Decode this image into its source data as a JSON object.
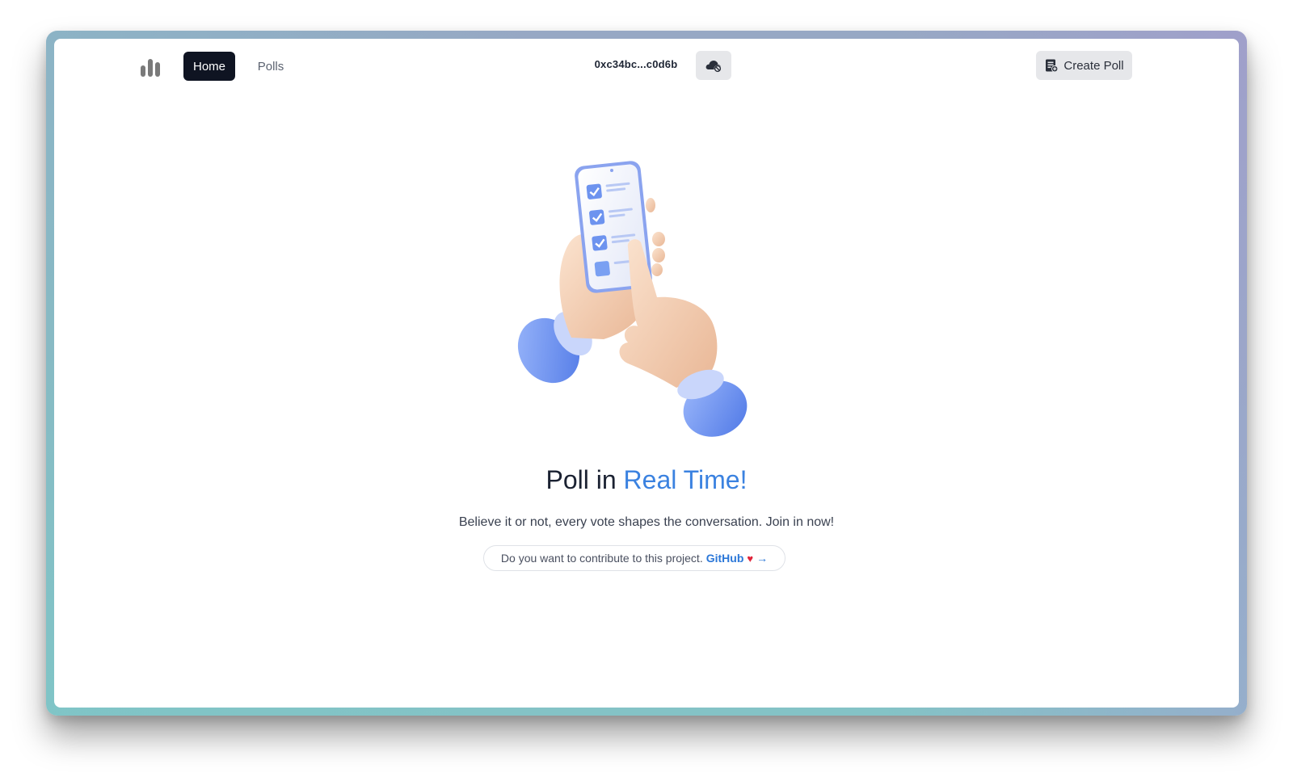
{
  "nav": {
    "logo_icon": "bar-chart-icon",
    "home_label": "Home",
    "polls_label": "Polls",
    "wallet_address": "0xc34bc...c0d6b",
    "cloud_icon": "cloud-off-icon",
    "create_poll_label": "Create Poll",
    "create_poll_icon": "note-add-icon"
  },
  "hero": {
    "title_prefix": "Poll in ",
    "title_accent": "Real Time!",
    "subtitle": "Believe it or not, every vote shapes the conversation. Join in now!",
    "contribute_text": "Do you want to contribute to this project.",
    "github_label": "GitHub",
    "heart": "♥",
    "arrow": "→"
  },
  "colors": {
    "accent": "#3b82e0",
    "nav_active_bg": "#0f1422",
    "button_bg": "#e6e7ea"
  }
}
